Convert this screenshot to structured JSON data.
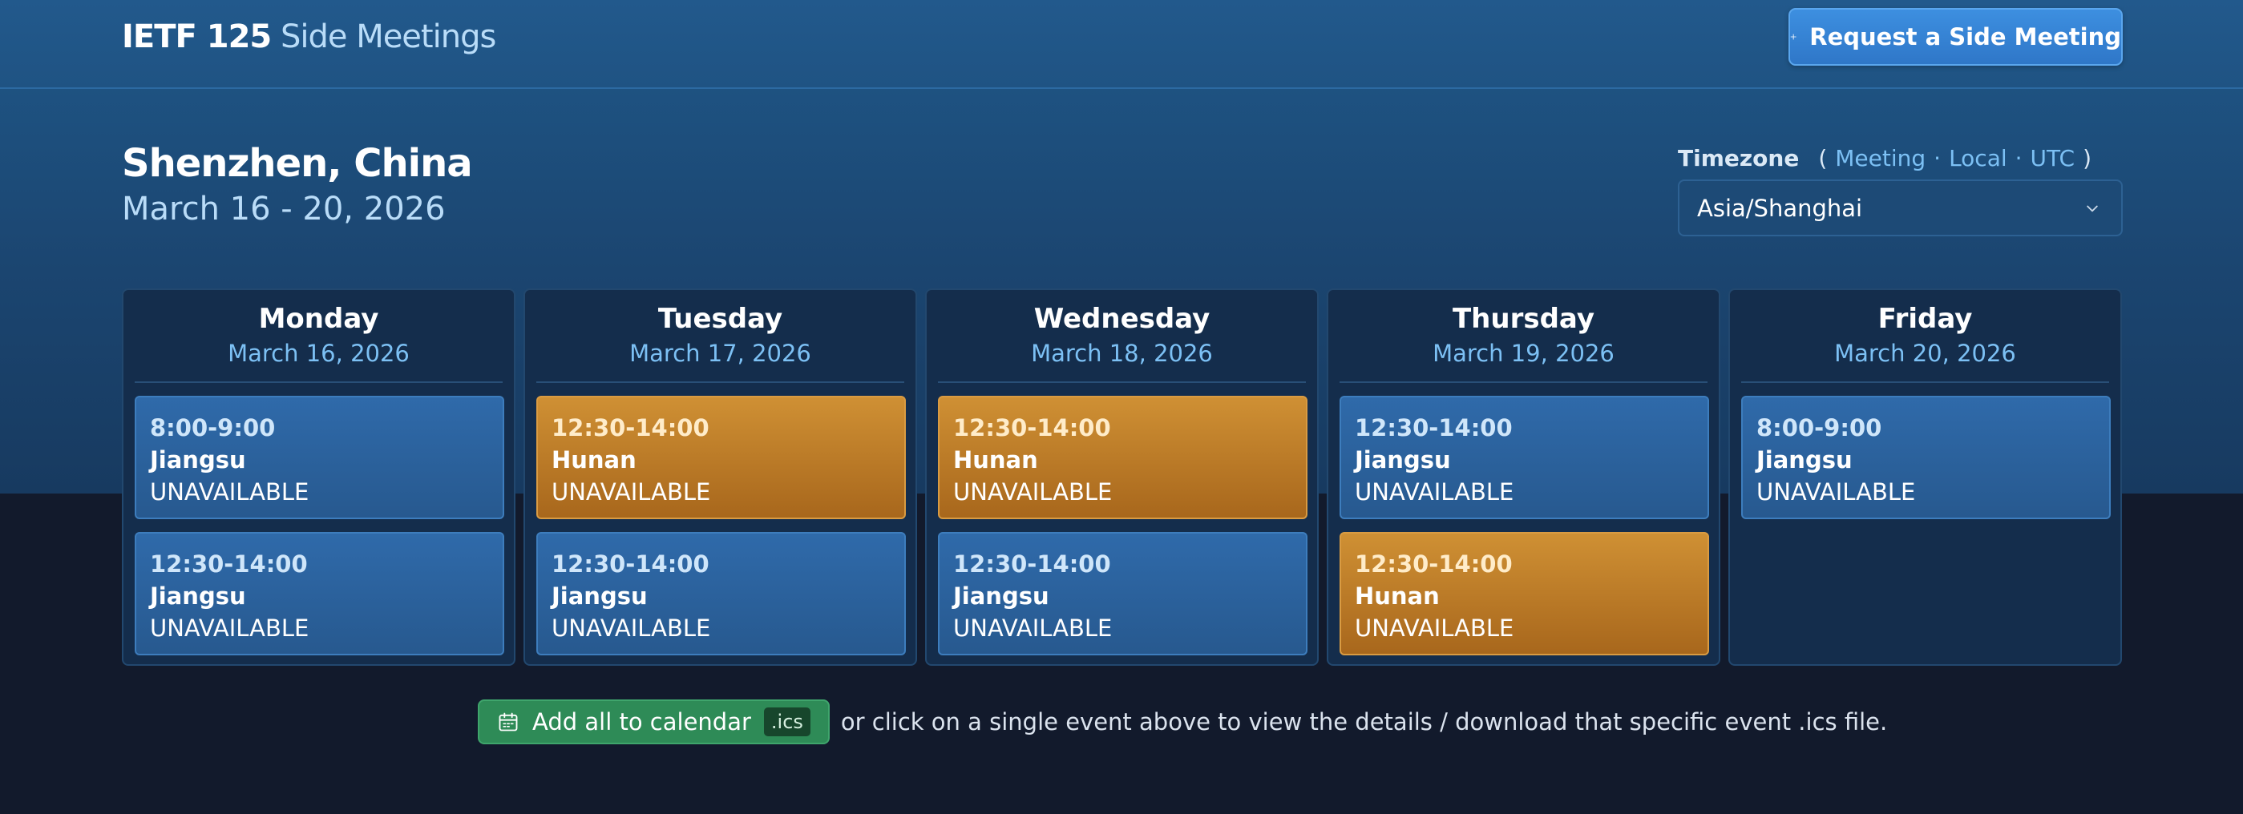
{
  "header": {
    "brand_strong": "IETF 125",
    "brand_light": "Side Meetings",
    "request_button_label": "Request a Side Meeting",
    "request_button_icon": "plus-icon"
  },
  "meeting": {
    "location": "Shenzhen, China",
    "dates": "March 16 - 20, 2026"
  },
  "timezone": {
    "label": "Timezone",
    "open_paren": "(",
    "close_paren": ")",
    "separator": "·",
    "links": [
      "Meeting",
      "Local",
      "UTC"
    ],
    "selected": "Asia/Shanghai"
  },
  "days": [
    {
      "name": "Monday",
      "date": "March 16, 2026",
      "events": [
        {
          "time": "8:00-9:00",
          "room": "Jiangsu",
          "status": "UNAVAILABLE",
          "color": "blue"
        },
        {
          "time": "12:30-14:00",
          "room": "Jiangsu",
          "status": "UNAVAILABLE",
          "color": "blue"
        }
      ]
    },
    {
      "name": "Tuesday",
      "date": "March 17, 2026",
      "events": [
        {
          "time": "12:30-14:00",
          "room": "Hunan",
          "status": "UNAVAILABLE",
          "color": "orange"
        },
        {
          "time": "12:30-14:00",
          "room": "Jiangsu",
          "status": "UNAVAILABLE",
          "color": "blue"
        }
      ]
    },
    {
      "name": "Wednesday",
      "date": "March 18, 2026",
      "events": [
        {
          "time": "12:30-14:00",
          "room": "Hunan",
          "status": "UNAVAILABLE",
          "color": "orange"
        },
        {
          "time": "12:30-14:00",
          "room": "Jiangsu",
          "status": "UNAVAILABLE",
          "color": "blue"
        }
      ]
    },
    {
      "name": "Thursday",
      "date": "March 19, 2026",
      "events": [
        {
          "time": "12:30-14:00",
          "room": "Jiangsu",
          "status": "UNAVAILABLE",
          "color": "blue"
        },
        {
          "time": "12:30-14:00",
          "room": "Hunan",
          "status": "UNAVAILABLE",
          "color": "orange"
        }
      ]
    },
    {
      "name": "Friday",
      "date": "March 20, 2026",
      "events": [
        {
          "time": "8:00-9:00",
          "room": "Jiangsu",
          "status": "UNAVAILABLE",
          "color": "blue"
        }
      ]
    }
  ],
  "footer": {
    "calendar_button_label": "Add all to calendar",
    "calendar_button_icon": "calendar-icon",
    "ics_badge": ".ics",
    "hint_text": "or click on a single event above to view the details / download that specific event .ics file."
  },
  "colors": {
    "event_blue": "#2f6aaa",
    "event_orange": "#cf9034",
    "accent_link": "#7cc0f4",
    "calendar_button": "#2e8b57",
    "request_button": "#3d8fe0"
  }
}
